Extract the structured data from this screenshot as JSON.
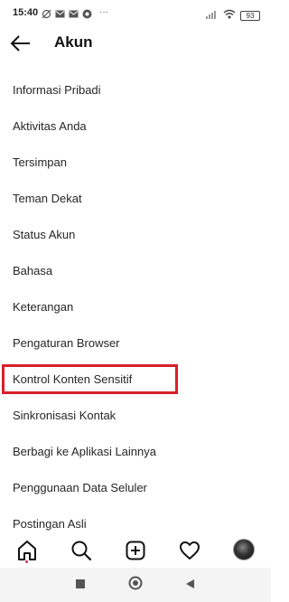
{
  "status_bar": {
    "time": "15:40",
    "left_icons": [
      "sync-off-icon",
      "mail-icon",
      "mail-icon",
      "vpn-icon"
    ],
    "more": "···",
    "battery": "93"
  },
  "header": {
    "back_icon": "arrow-left-icon",
    "title": "Akun"
  },
  "menu": {
    "items": [
      {
        "label": "Informasi Pribadi"
      },
      {
        "label": "Aktivitas Anda"
      },
      {
        "label": "Tersimpan"
      },
      {
        "label": "Teman Dekat"
      },
      {
        "label": "Status Akun"
      },
      {
        "label": "Bahasa"
      },
      {
        "label": "Keterangan"
      },
      {
        "label": "Pengaturan Browser"
      },
      {
        "label": "Kontrol Konten Sensitif"
      },
      {
        "label": "Sinkronisasi Kontak"
      },
      {
        "label": "Berbagi ke Aplikasi Lainnya"
      },
      {
        "label": "Penggunaan Data Seluler"
      },
      {
        "label": "Postingan Asli"
      }
    ],
    "highlighted_item": "Kontrol Konten Sensitif",
    "highlight_color": "#d8202a"
  },
  "bottom_nav": {
    "items": [
      "home-icon",
      "search-icon",
      "add-post-icon",
      "heart-icon",
      "profile-avatar"
    ],
    "active": "home-icon",
    "active_dot_color": "#e0245e"
  },
  "system_nav": {
    "items": [
      "square-recents-icon",
      "circle-home-icon",
      "triangle-back-icon"
    ]
  }
}
